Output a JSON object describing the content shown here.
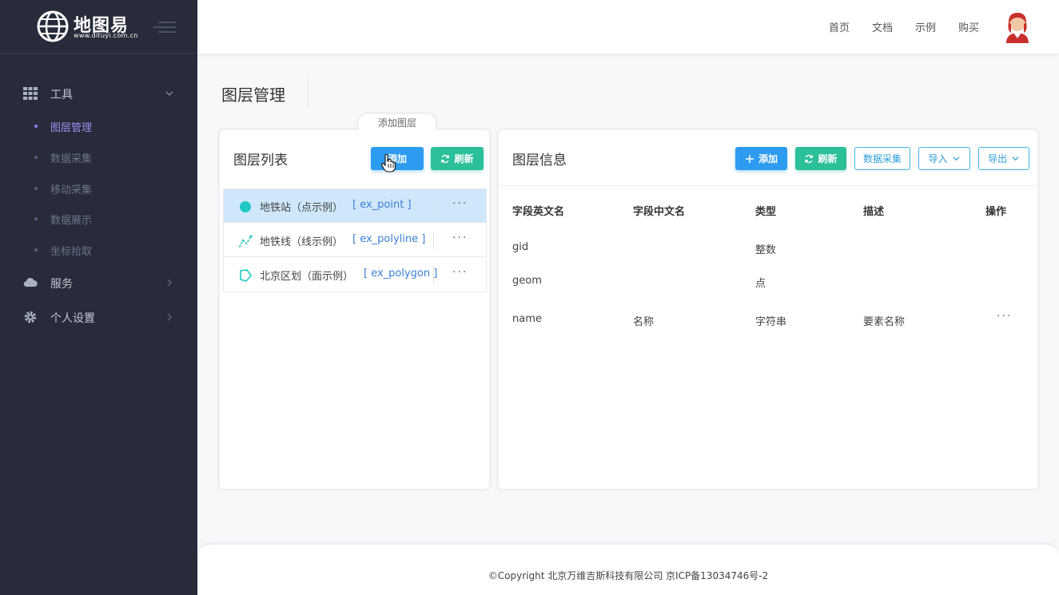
{
  "logo": {
    "title": "地图易",
    "url": "www.dituyi.com.cn"
  },
  "sidebar": {
    "groups": [
      {
        "label": "工具",
        "icon": "grid-icon"
      },
      {
        "label": "服务",
        "icon": "cloud-icon"
      },
      {
        "label": "个人设置",
        "icon": "gear-icon"
      }
    ],
    "tool_items": [
      {
        "label": "图层管理"
      },
      {
        "label": "数据采集"
      },
      {
        "label": "移动采集"
      },
      {
        "label": "数据展示"
      },
      {
        "label": "坐标拾取"
      }
    ]
  },
  "header": {
    "nav": [
      {
        "label": "首页"
      },
      {
        "label": "文档"
      },
      {
        "label": "示例"
      },
      {
        "label": "购买"
      }
    ]
  },
  "page": {
    "title": "图层管理"
  },
  "left_panel": {
    "tab_label": "添加图层",
    "title": "图层列表",
    "add_label": "添加",
    "refresh_label": "刷新",
    "layers": [
      {
        "name": "地铁站（点示例）",
        "code": "[ ex_point ]",
        "icon": "point-icon",
        "more": "···"
      },
      {
        "name": "地铁线（线示例）",
        "code": "[ ex_polyline ]",
        "icon": "polyline-icon",
        "more": "···"
      },
      {
        "name": "北京区划（面示例）",
        "code": "[ ex_polygon ]",
        "icon": "polygon-icon",
        "more": "···"
      }
    ]
  },
  "right_panel": {
    "title": "图层信息",
    "add_label": "添加",
    "refresh_label": "刷新",
    "collect_label": "数据采集",
    "import_label": "导入",
    "export_label": "导出",
    "columns": [
      "字段英文名",
      "字段中文名",
      "类型",
      "描述",
      "操作"
    ],
    "rows": [
      {
        "en": "gid",
        "cn": "",
        "type": "整数",
        "desc": "",
        "op": ""
      },
      {
        "en": "geom",
        "cn": "",
        "type": "点",
        "desc": "",
        "op": ""
      },
      {
        "en": "name",
        "cn": "名称",
        "type": "字符串",
        "desc": "要素名称",
        "op": "···"
      }
    ]
  },
  "footer": {
    "text": "©Copyright 北京万维吉斯科技有限公司 京ICP备13034746号-2"
  },
  "colors": {
    "sidebar_bg": "#272b3a",
    "accent_purple": "#9d8ff0",
    "primary_blue": "#2d9cf0",
    "teal": "#2bbf9a",
    "selected_row": "#cfe6fb"
  }
}
